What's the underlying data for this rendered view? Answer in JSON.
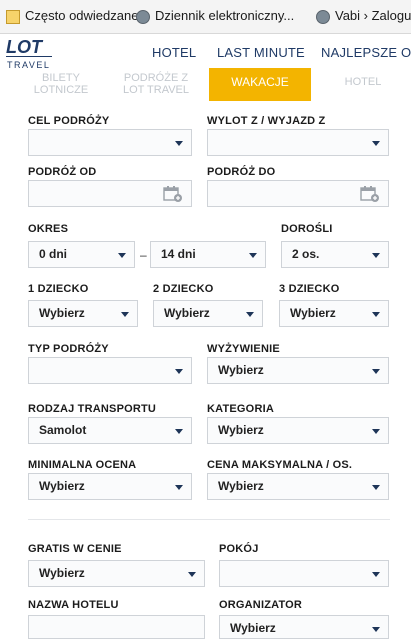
{
  "bookmarks": [
    {
      "label": "Często odwiedzane",
      "icon": "bookmark-icon"
    },
    {
      "label": "Dziennik elektroniczny...",
      "icon": "globe-icon"
    },
    {
      "label": "Vabi › Zaloguj",
      "icon": "globe-icon"
    }
  ],
  "brand": {
    "logo": "LOT",
    "sub": "TRAVEL"
  },
  "nav": {
    "hotel": "HOTEL",
    "last_minute": "LAST MINUTE",
    "najlepsze": "NAJLEPSZE OFE"
  },
  "tabs": {
    "bilety": "BILETY LOTNICZE",
    "podroze": "PODRÓŻE Z LOT TRAVEL",
    "wakacje": "WAKACJE",
    "hotel": "HOTEL"
  },
  "form": {
    "cel_label": "CEL PODRÓŻY",
    "wylot_label": "WYLOT Z / WYJAZD Z",
    "od_label": "PODRÓŻ OD",
    "do_label": "PODRÓŻ DO",
    "okres_label": "OKRES",
    "okres_from": "0 dni",
    "okres_sep": "–",
    "okres_to": "14 dni",
    "dorosli_label": "DOROŚLI",
    "dorosli_value": "2 os.",
    "dziecko1_label": "1 DZIECKO",
    "dziecko1_value": "Wybierz",
    "dziecko2_label": "2 DZIECKO",
    "dziecko2_value": "Wybierz",
    "dziecko3_label": "3 DZIECKO",
    "dziecko3_value": "Wybierz",
    "typ_label": "TYP PODRÓŻY",
    "wyzywienie_label": "WYŻYWIENIE",
    "wyzywienie_value": "Wybierz",
    "transport_label": "RODZAJ TRANSPORTU",
    "transport_value": "Samolot",
    "kategoria_label": "KATEGORIA",
    "kategoria_value": "Wybierz",
    "ocena_label": "MINIMALNA OCENA",
    "ocena_value": "Wybierz",
    "cena_label": "CENA MAKSYMALNA / OS.",
    "cena_value": "Wybierz",
    "gratis_label": "GRATIS W CENIE",
    "gratis_value": "Wybierz",
    "pokoj_label": "POKÓJ",
    "hotel_label": "NAZWA HOTELU",
    "organizator_label": "ORGANIZATOR",
    "organizator_value": "Wybierz"
  },
  "colors": {
    "accent": "#f3b400",
    "brand": "#1f3a66"
  }
}
